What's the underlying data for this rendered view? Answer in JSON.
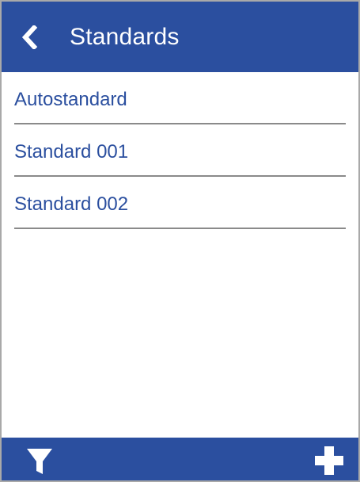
{
  "header": {
    "title": "Standards",
    "back_icon": "chevron-left-icon"
  },
  "list": {
    "items": [
      {
        "label": "Autostandard"
      },
      {
        "label": "Standard 001"
      },
      {
        "label": "Standard 002"
      }
    ]
  },
  "footer": {
    "left_icon": "filter-icon",
    "right_icon": "plus-icon"
  },
  "colors": {
    "accent": "#2b4f9f",
    "divider": "#8a8a8a",
    "background": "#ffffff"
  }
}
